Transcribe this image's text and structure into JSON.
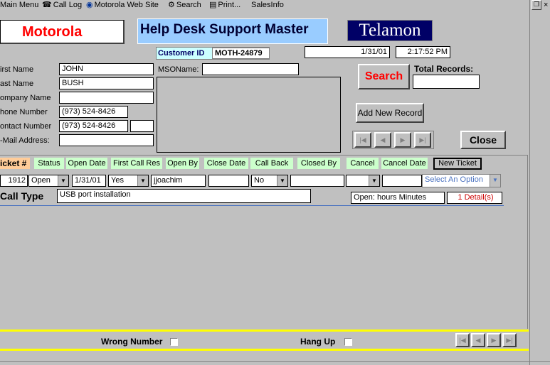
{
  "menubar": {
    "items": [
      {
        "label": "Main Menu",
        "icon": "none"
      },
      {
        "label": "Call Log",
        "icon": "phone-icon"
      },
      {
        "label": "Motorola Web Site",
        "icon": "globe-icon"
      },
      {
        "label": "Search",
        "icon": "search-icon"
      },
      {
        "label": "Print...",
        "icon": "print-icon"
      },
      {
        "label": "SalesInfo",
        "icon": "none"
      }
    ]
  },
  "header": {
    "logo_motorola": "Motorola",
    "title": "Help Desk Support Master",
    "logo_telamon": "Telamon",
    "customer_id_label": "Customer ID",
    "customer_id_value": "MOTH-24879",
    "date": "1/31/01",
    "time": "2:17:52 PM"
  },
  "customer": {
    "first_name_label": "irst Name",
    "first_name": "JOHN",
    "last_name_label": "ast Name",
    "last_name": "BUSH",
    "company_label": "ompany Name",
    "company": "",
    "phone_label": "hone Number",
    "phone": "(973) 524-8426",
    "contact_label": "ontact Number",
    "contact": "(973) 524-8426",
    "contact_ext": "",
    "email_label": "-Mail Address:",
    "email": "",
    "msoname_label": "MSOName:",
    "msoname": ""
  },
  "actions": {
    "search": "Search",
    "total_records_label": "Total Records:",
    "total_records": "",
    "add_new_record": "Add New Record",
    "close": "Close"
  },
  "ticket_headers": {
    "ticket": "icket #",
    "status": "Status",
    "open_date": "Open Date",
    "first_call_res": "First Call Res",
    "open_by": "Open By",
    "close_date": "Close Date",
    "call_back": "Call Back",
    "closed_by": "Closed By",
    "cancel": "Cancel",
    "cancel_date": "Cancel Date",
    "new_ticket": "New Ticket"
  },
  "ticket_row": {
    "number": "1912",
    "status": "Open",
    "open_date": "1/31/01",
    "first_call_res": "Yes",
    "open_by": "jjoachim",
    "close_date": "",
    "call_back": "No",
    "closed_by": "",
    "cancel": "",
    "cancel_date": "",
    "option": "Select An Option"
  },
  "call": {
    "type_label": "Call Type",
    "type_value": "USB port installation",
    "open_hours": "Open:  hours    Minutes",
    "details": "1 Detail(s)"
  },
  "footer": {
    "wrong_number": "Wrong Number",
    "hang_up": "Hang Up"
  },
  "colors": {
    "bg": "#c0c0c0",
    "motorola_red": "#ff0000",
    "title_bg": "#99ccff",
    "telamon_navy": "#000066",
    "header_green": "#ccffcc",
    "ticket_orange": "#ffcc99",
    "yellow_line": "#ffff00"
  }
}
